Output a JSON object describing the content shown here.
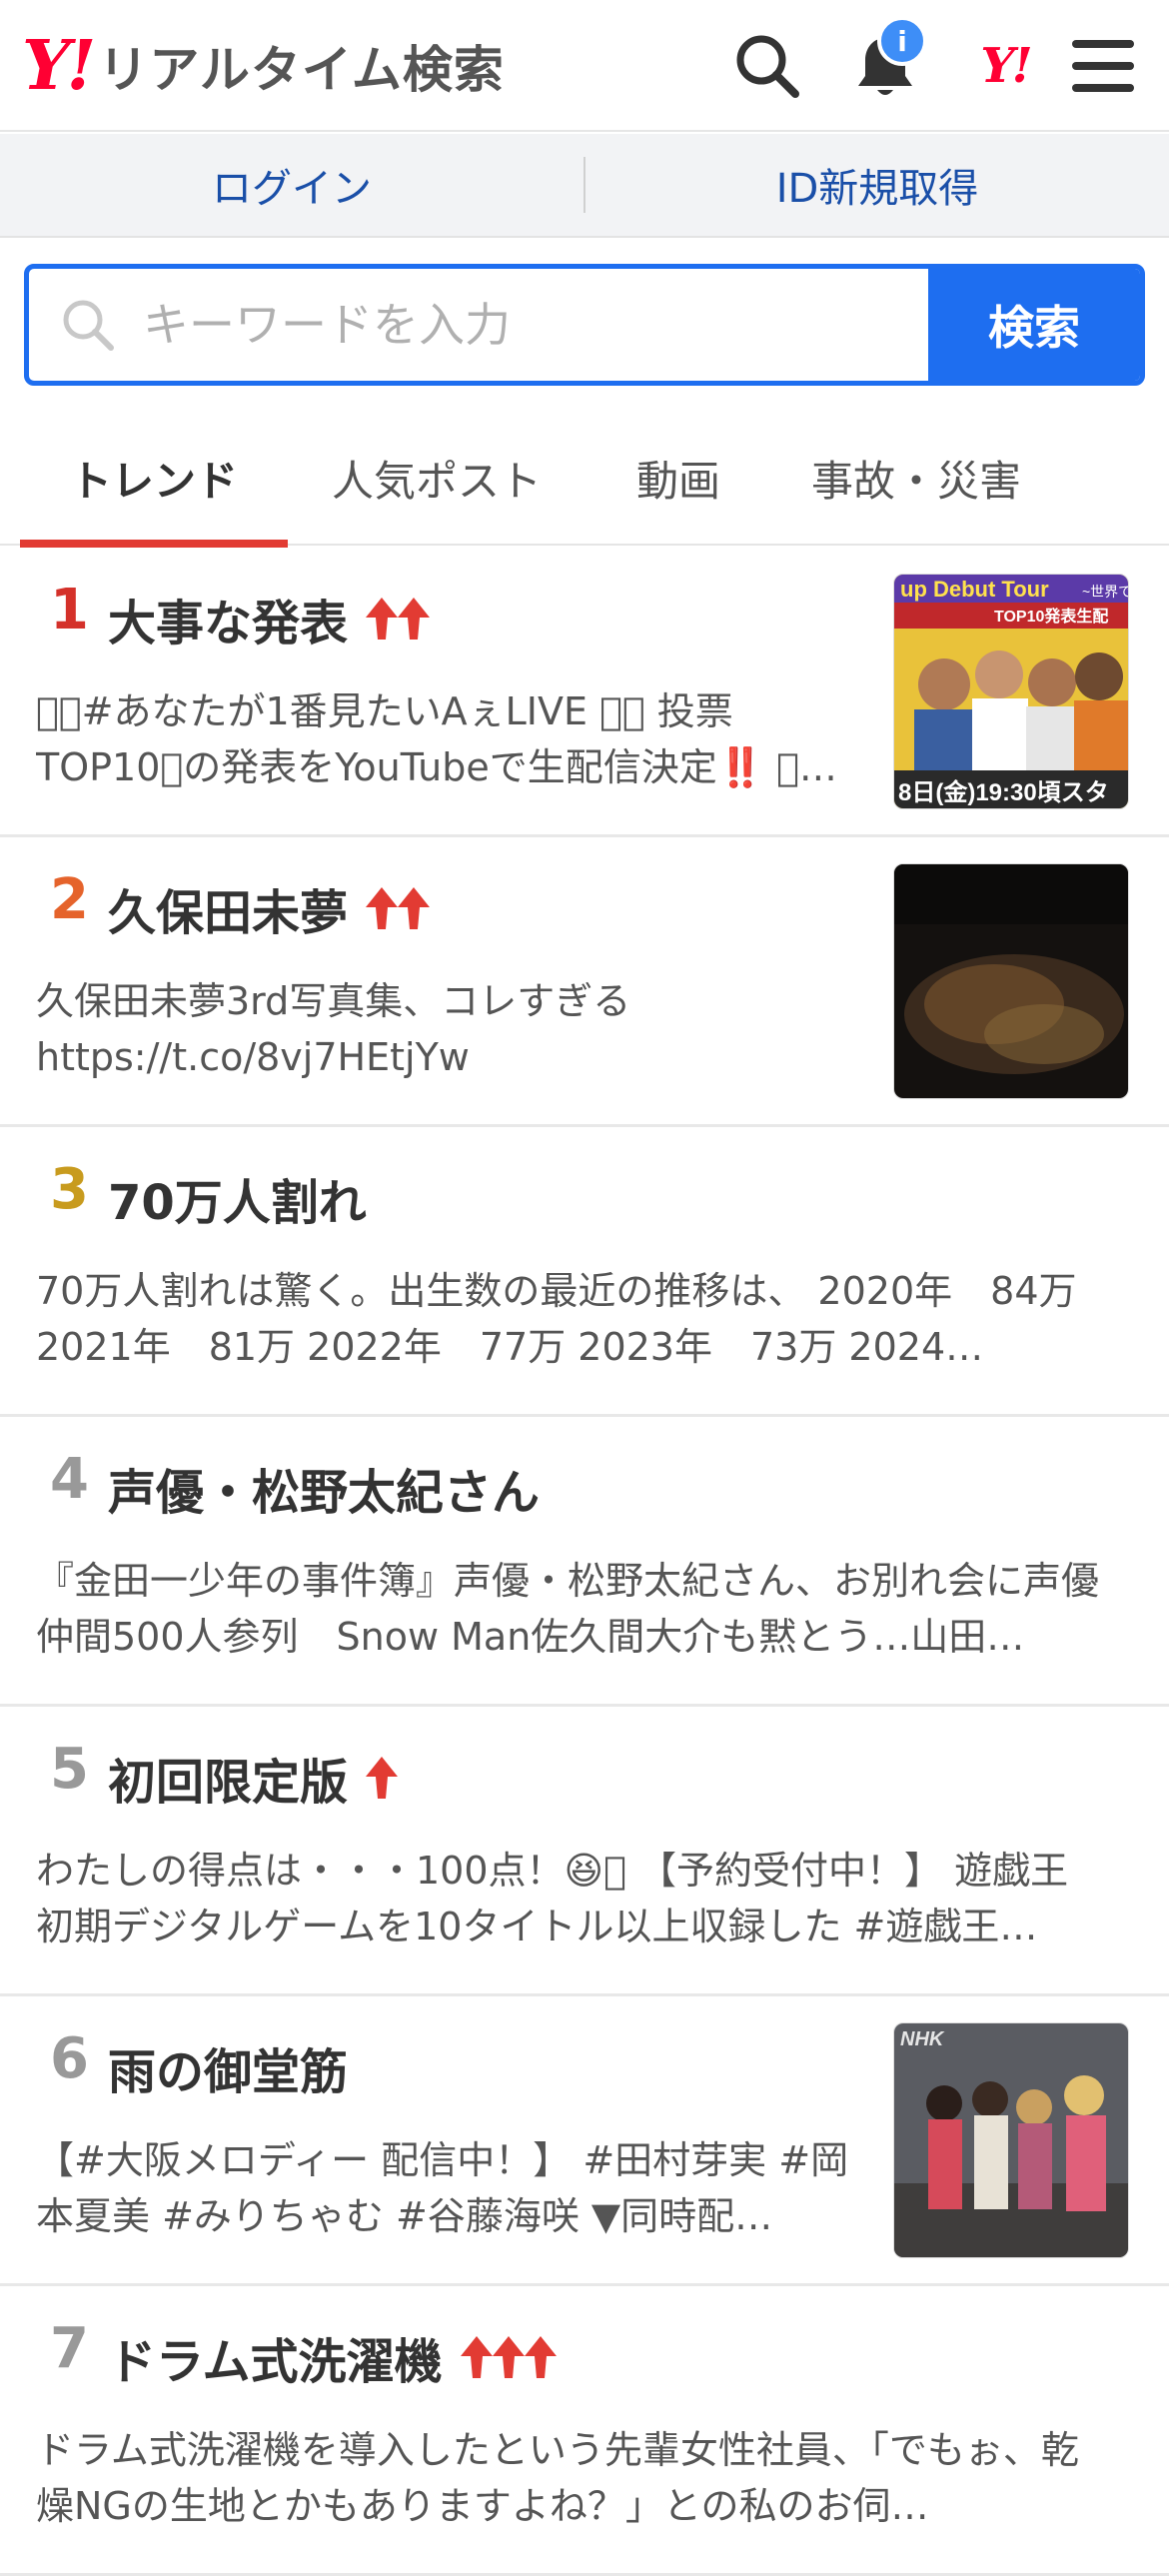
{
  "header": {
    "logo_mark": "Y!",
    "logo_text": "リアルタイム検索",
    "notification_badge": "i",
    "yj_mark": "Y!"
  },
  "account": {
    "login_label": "ログイン",
    "register_label": "ID新規取得"
  },
  "search": {
    "placeholder": "キーワードを入力",
    "button_label": "検索"
  },
  "tabs": [
    {
      "label": "トレンド",
      "active": true
    },
    {
      "label": "人気ポスト",
      "active": false
    },
    {
      "label": "動画",
      "active": false
    },
    {
      "label": "事故・災害",
      "active": false
    }
  ],
  "trends": [
    {
      "rank": "1",
      "title": "大事な発表",
      "arrows": 2,
      "rank_color": "#d4312a",
      "text": "＼􀀀#あなたが1番見たいAぇLIVE 􀀀／ 投票TOP10􀀀の発表をYouTubeで生配信決定‼️ 􀀀…",
      "thumb": "thumb-live-tour"
    },
    {
      "rank": "2",
      "title": "久保田未夢",
      "arrows": 2,
      "rank_color": "#e5632b",
      "text": "久保田未夢3rd写真集、コレすぎる https://t.co/8vj7HEtjYw",
      "thumb": "thumb-dark"
    },
    {
      "rank": "3",
      "title": "70万人割れ",
      "arrows": 0,
      "rank_color": "#c89b1e",
      "text": "70万人割れは驚く。出生数の最近の推移は、 2020年　84万 2021年　81万 2022年　77万 2023年　73万 2024…",
      "thumb": ""
    },
    {
      "rank": "4",
      "title": "声優・松野太紀さん",
      "arrows": 0,
      "rank_color": "#999999",
      "text": "『金田一少年の事件簿』声優・松野太紀さん、お別れ会に声優仲間500人参列　Snow Man佐久間大介も黙とう…山田…",
      "thumb": ""
    },
    {
      "rank": "5",
      "title": "初回限定版",
      "arrows": 1,
      "rank_color": "#999999",
      "text": "わたしの得点は・・・100点！😆􀀀 【予約受付中！】 遊戯王初期デジタルゲームを10タイトル以上収録した #遊戯王…",
      "thumb": ""
    },
    {
      "rank": "6",
      "title": "雨の御堂筋",
      "arrows": 0,
      "rank_color": "#999999",
      "text": "【#大阪メロディー 配信中！】 #田村芽実 #岡本夏美 #みりちゃむ #谷藤海咲 ▼同時配…",
      "thumb": "thumb-nhk"
    },
    {
      "rank": "7",
      "title": "ドラム式洗濯機",
      "arrows": 3,
      "rank_color": "#999999",
      "text": "ドラム式洗濯機を導入したという先輩女性社員、「でもぉ、乾燥NGの生地とかもありますよね？」との私のお伺…",
      "thumb": ""
    }
  ],
  "colors": {
    "brand_red": "#ff0033",
    "accent_blue": "#1e6ef0",
    "tab_underline": "#e23b33",
    "arrow_red": "#e23b33"
  },
  "thumb_texts": {
    "live_tour_line1": "up Debut Tour",
    "live_tour_line2": "~世界で",
    "live_tour_line3": "TOP10発表生配",
    "live_tour_date": "8日(金)19:30頃スタ",
    "nhk": "NHK"
  }
}
